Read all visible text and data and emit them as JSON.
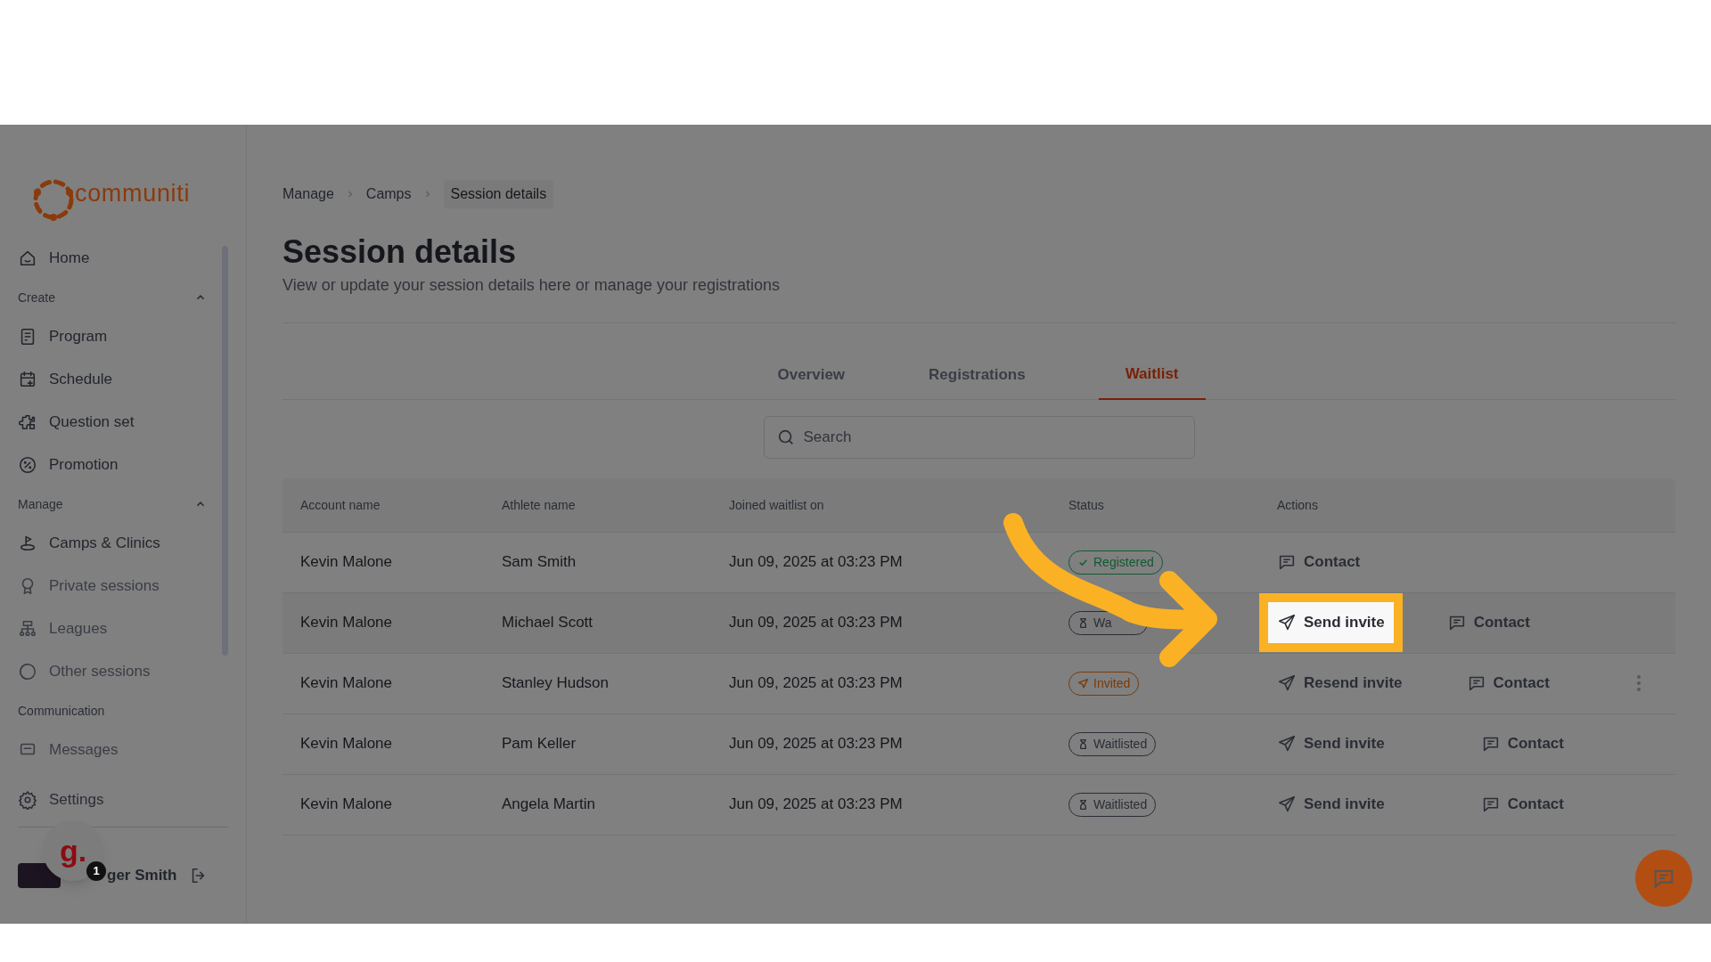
{
  "sidebar": {
    "logo": "communiti",
    "nav": [
      {
        "kind": "item",
        "label": "Home"
      },
      {
        "kind": "section",
        "label": "Create",
        "expanded": true
      },
      {
        "kind": "item",
        "label": "Program"
      },
      {
        "kind": "item",
        "label": "Schedule"
      },
      {
        "kind": "item",
        "label": "Question set"
      },
      {
        "kind": "item",
        "label": "Promotion"
      },
      {
        "kind": "section",
        "label": "Manage",
        "expanded": true
      },
      {
        "kind": "item",
        "label": "Camps & Clinics"
      },
      {
        "kind": "item",
        "label": "Private sessions"
      },
      {
        "kind": "item",
        "label": "Leagues"
      },
      {
        "kind": "item",
        "label": "Other sessions"
      },
      {
        "kind": "section",
        "label": "Communication"
      },
      {
        "kind": "item",
        "label": "Messages"
      }
    ],
    "settings": "Settings",
    "user_name": "ger Smith",
    "widget": {
      "letter": "g.",
      "badge": "1"
    }
  },
  "breadcrumb": [
    {
      "label": "Manage",
      "current": false
    },
    {
      "label": "Camps",
      "current": false
    },
    {
      "label": "Session details",
      "current": true
    }
  ],
  "title": "Session details",
  "subtitle": "View or update your session details here or manage your registrations",
  "tabs": [
    {
      "label": "Overview",
      "selected": false
    },
    {
      "label": "Registrations",
      "selected": false
    },
    {
      "label": "Waitlist",
      "selected": true
    }
  ],
  "search": {
    "placeholder": "Search"
  },
  "table": {
    "columns": [
      "Account name",
      "Athlete name",
      "Joined waitlist on",
      "Status",
      "Actions"
    ],
    "rows": [
      {
        "account": "Kevin Malone",
        "athlete": "Sam Smith",
        "joined": "Jun 09, 2025 at 03:23 PM",
        "status": {
          "kind": "registered",
          "label": "Registered"
        },
        "hovered": false,
        "menu": false,
        "actions": [
          {
            "kind": "contact",
            "label": "Contact",
            "highlighted": false
          }
        ]
      },
      {
        "account": "Kevin Malone",
        "athlete": "Michael Scott",
        "joined": "Jun 09, 2025 at 03:23 PM",
        "status": {
          "kind": "waitlisted",
          "label": "Wa"
        },
        "hovered": true,
        "menu": false,
        "actions": [
          {
            "kind": "send",
            "label": "Send invite",
            "highlighted": true
          },
          {
            "kind": "contact",
            "label": "Contact",
            "highlighted": false
          }
        ]
      },
      {
        "account": "Kevin Malone",
        "athlete": "Stanley Hudson",
        "joined": "Jun 09, 2025 at 03:23 PM",
        "status": {
          "kind": "invited",
          "label": "Invited"
        },
        "hovered": false,
        "menu": true,
        "actions": [
          {
            "kind": "send",
            "label": "Resend invite",
            "highlighted": false
          },
          {
            "kind": "contact",
            "label": "Contact",
            "highlighted": false
          }
        ]
      },
      {
        "account": "Kevin Malone",
        "athlete": "Pam Keller",
        "joined": "Jun 09, 2025 at 03:23 PM",
        "status": {
          "kind": "waitlisted",
          "label": "Waitlisted"
        },
        "hovered": false,
        "menu": false,
        "actions": [
          {
            "kind": "send",
            "label": "Send invite",
            "highlighted": false
          },
          {
            "kind": "contact",
            "label": "Contact",
            "highlighted": false
          }
        ]
      },
      {
        "account": "Kevin Malone",
        "athlete": "Angela Martin",
        "joined": "Jun 09, 2025 at 03:23 PM",
        "status": {
          "kind": "waitlisted",
          "label": "Waitlisted"
        },
        "hovered": false,
        "menu": false,
        "actions": [
          {
            "kind": "send",
            "label": "Send invite",
            "highlighted": false
          },
          {
            "kind": "contact",
            "label": "Contact",
            "highlighted": false
          }
        ]
      }
    ]
  }
}
